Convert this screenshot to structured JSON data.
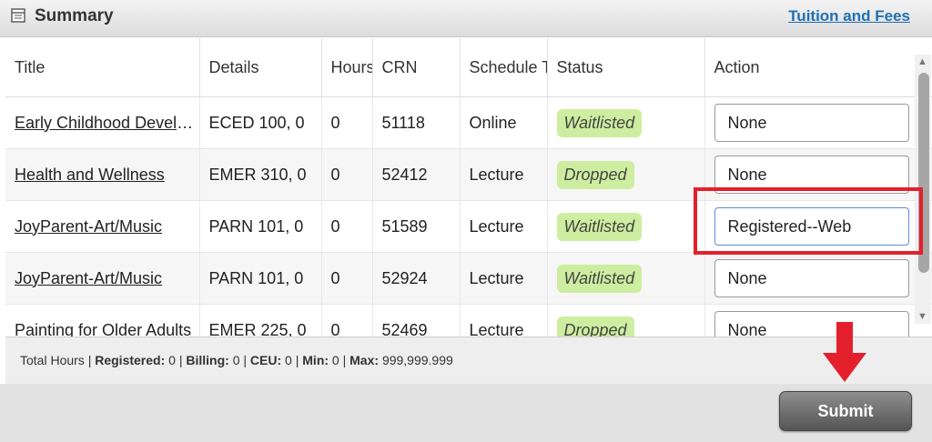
{
  "header": {
    "title": "Summary",
    "tuition_link": "Tuition and Fees"
  },
  "table": {
    "columns": [
      "Title",
      "Details",
      "Hours",
      "CRN",
      "Schedule Type",
      "Status",
      "Action"
    ],
    "rows": [
      {
        "title": "Early Childhood Development",
        "details": "ECED 100, 0",
        "hours": "0",
        "crn": "51118",
        "schedule": "Online",
        "status": "Waitlisted",
        "action": "None"
      },
      {
        "title": "Health and Wellness",
        "details": "EMER 310, 0",
        "hours": "0",
        "crn": "52412",
        "schedule": "Lecture",
        "status": "Dropped",
        "action": "None"
      },
      {
        "title": "JoyParent-Art/Music",
        "details": "PARN 101, 0",
        "hours": "0",
        "crn": "51589",
        "schedule": "Lecture",
        "status": "Waitlisted",
        "action": "Registered--Web"
      },
      {
        "title": "JoyParent-Art/Music",
        "details": "PARN 101, 0",
        "hours": "0",
        "crn": "52924",
        "schedule": "Lecture",
        "status": "Waitlisted",
        "action": "None"
      },
      {
        "title": "Painting for Older Adults",
        "details": "EMER 225, 0",
        "hours": "0",
        "crn": "52469",
        "schedule": "Lecture",
        "status": "Dropped",
        "action": "None"
      }
    ]
  },
  "footer": {
    "total_label": "Total Hours |",
    "registered_label": "Registered:",
    "registered_value": "0",
    "billing_label": "Billing:",
    "billing_value": "0",
    "ceu_label": "CEU:",
    "ceu_value": "0",
    "min_label": "Min:",
    "min_value": "0",
    "max_label": "Max:",
    "max_value": "999,999.999"
  },
  "submit_label": "Submit",
  "icons": {
    "summary": "table-icon",
    "arrow": "down-arrow-icon",
    "scroll_up": "scroll-up-icon",
    "scroll_down": "scroll-down-icon"
  },
  "colors": {
    "status_bg": "#cdeea0",
    "highlight": "#e3202c",
    "link": "#1f6fb2"
  }
}
